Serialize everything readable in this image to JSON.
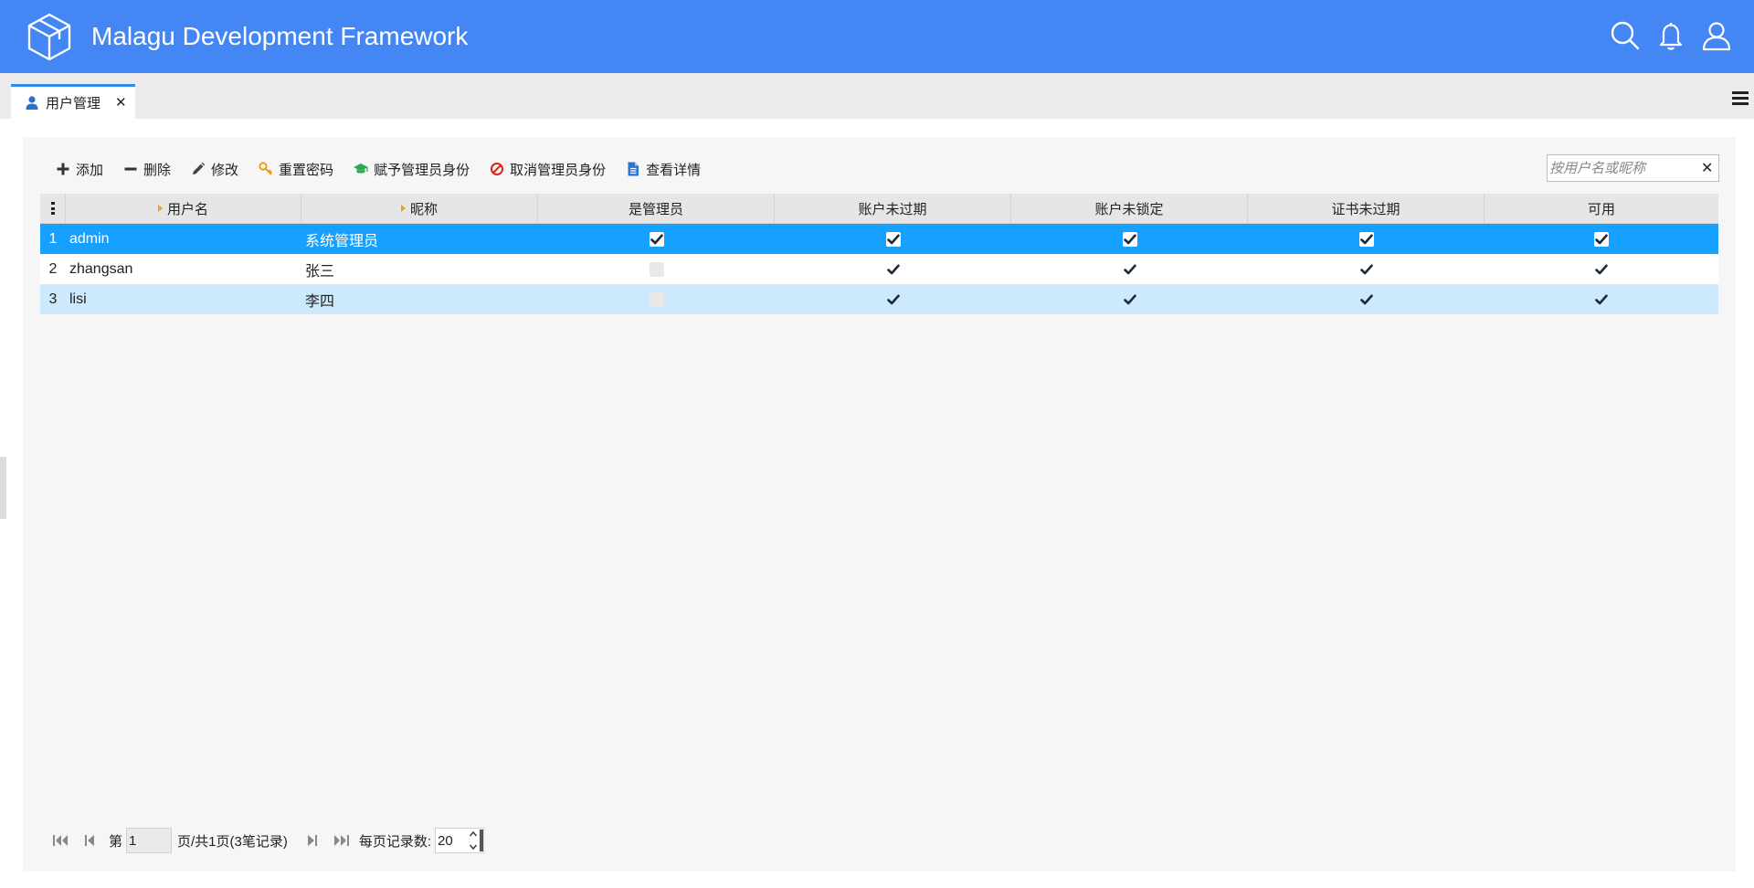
{
  "header": {
    "title": "Malagu Development Framework",
    "logo_icon": "cube-icon",
    "icons": [
      "search-icon",
      "bell-icon",
      "user-icon"
    ],
    "color": "#4386f4"
  },
  "tabs": [
    {
      "label": "用户管理",
      "icon": "user-icon",
      "active": true
    }
  ],
  "toolbar": {
    "add": "添加",
    "delete": "删除",
    "edit": "修改",
    "reset_password": "重置密码",
    "grant_admin": "赋予管理员身份",
    "revoke_admin": "取消管理员身份",
    "view_details": "查看详情"
  },
  "search": {
    "placeholder": "按用户名或昵称",
    "value": ""
  },
  "grid": {
    "columns": [
      "用户名",
      "昵称",
      "是管理员",
      "账户未过期",
      "账户未锁定",
      "证书未过期",
      "可用"
    ],
    "rows": [
      {
        "num": "1",
        "username": "admin",
        "nickname": "系统管理员",
        "is_admin": true,
        "not_expired": true,
        "not_locked": true,
        "cred_not_expired": true,
        "enabled": true,
        "selected": true
      },
      {
        "num": "2",
        "username": "zhangsan",
        "nickname": "张三",
        "is_admin": false,
        "not_expired": true,
        "not_locked": true,
        "cred_not_expired": true,
        "enabled": true,
        "selected": false
      },
      {
        "num": "3",
        "username": "lisi",
        "nickname": "李四",
        "is_admin": false,
        "not_expired": true,
        "not_locked": true,
        "cred_not_expired": true,
        "enabled": true,
        "selected": false
      }
    ],
    "selected_color": "#16a0ff",
    "hover_color": "#cde9fc"
  },
  "pager": {
    "page_prefix": "第",
    "page_value": "1",
    "page_suffix": "页/共1页(3笔记录)",
    "page_size_label": "每页记录数:",
    "page_size_value": "20"
  }
}
